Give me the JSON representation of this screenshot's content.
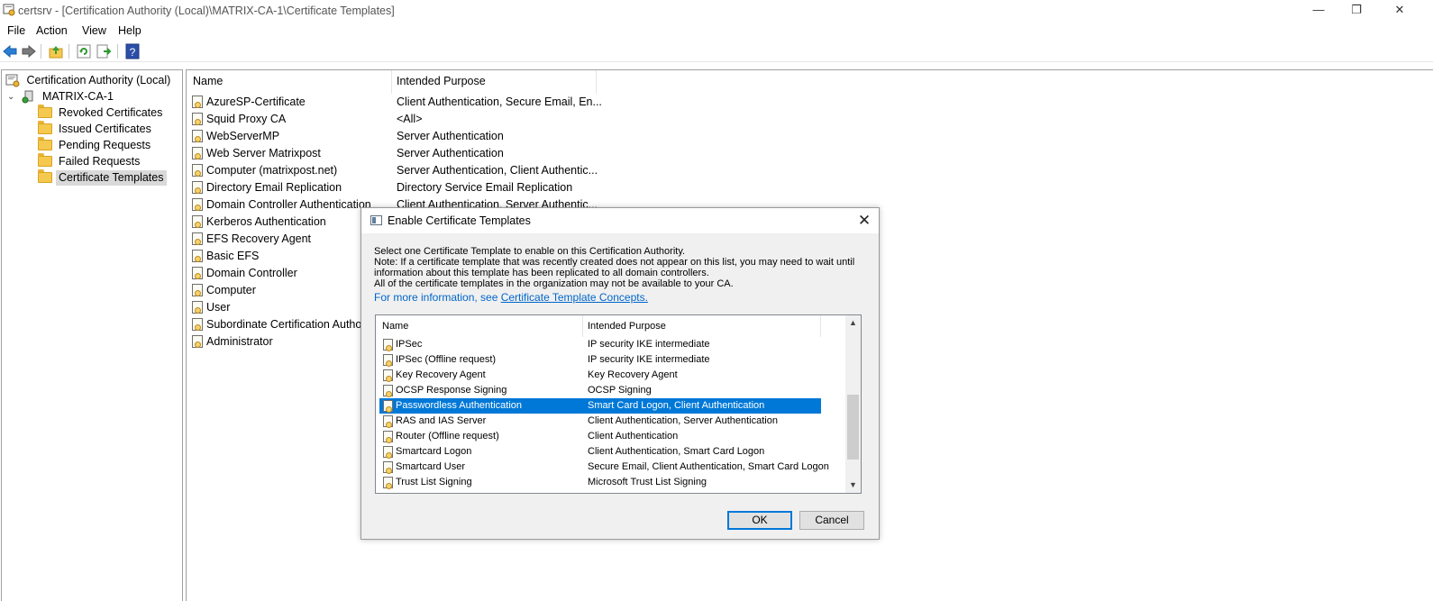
{
  "window": {
    "title": "certsrv - [Certification Authority (Local)\\MATRIX-CA-1\\Certificate Templates]",
    "minimize_glyph": "—",
    "restore_glyph": "❐",
    "close_glyph": "✕"
  },
  "menu": [
    "File",
    "Action",
    "View",
    "Help"
  ],
  "toolbar": {
    "icons": [
      "back-arrow-icon",
      "forward-arrow-icon",
      "up-folder-icon",
      "refresh-icon",
      "export-list-icon",
      "help-icon"
    ],
    "help_glyph": "?"
  },
  "tree": {
    "root": "Certification Authority (Local)",
    "ca": "MATRIX-CA-1",
    "items": [
      "Revoked Certificates",
      "Issued Certificates",
      "Pending Requests",
      "Failed Requests",
      "Certificate Templates"
    ],
    "selected": "Certificate Templates"
  },
  "list": {
    "headers": {
      "name": "Name",
      "purpose": "Intended Purpose"
    },
    "rows": [
      {
        "name": "AzureSP-Certificate",
        "purpose": "Client Authentication, Secure Email, En..."
      },
      {
        "name": "Squid Proxy CA",
        "purpose": "<All>"
      },
      {
        "name": "WebServerMP",
        "purpose": "Server Authentication"
      },
      {
        "name": " Web Server Matrixpost",
        "purpose": "Server Authentication"
      },
      {
        "name": "Computer (matrixpost.net)",
        "purpose": "Server Authentication, Client Authentic..."
      },
      {
        "name": "Directory Email Replication",
        "purpose": "Directory Service Email Replication"
      },
      {
        "name": "Domain Controller Authentication",
        "purpose": "Client Authentication, Server Authentic..."
      },
      {
        "name": "Kerberos Authentication",
        "purpose": ""
      },
      {
        "name": "EFS Recovery Agent",
        "purpose": ""
      },
      {
        "name": "Basic EFS",
        "purpose": ""
      },
      {
        "name": "Domain Controller",
        "purpose": ""
      },
      {
        "name": "Computer",
        "purpose": ""
      },
      {
        "name": "User",
        "purpose": ""
      },
      {
        "name": "Subordinate Certification Authority",
        "purpose": ""
      },
      {
        "name": "Administrator",
        "purpose": ""
      }
    ]
  },
  "dialog": {
    "title": "Enable Certificate Templates",
    "close_glyph": "✕",
    "text_lines": [
      "Select one Certificate Template to enable on this Certification Authority.",
      "Note: If a certificate template that was recently created does not appear on this list, you may need to wait until",
      "information about this template has been replicated to all domain controllers.",
      "All of the certificate templates in the organization may not be available to your CA."
    ],
    "more_info_prefix": "For more information, see ",
    "more_info_link": "Certificate Template Concepts.",
    "list_headers": {
      "name": "Name",
      "purpose": "Intended Purpose"
    },
    "rows": [
      {
        "name": "IPSec",
        "purpose": "IP security IKE intermediate"
      },
      {
        "name": "IPSec (Offline request)",
        "purpose": "IP security IKE intermediate"
      },
      {
        "name": "Key Recovery Agent",
        "purpose": "Key Recovery Agent"
      },
      {
        "name": "OCSP Response Signing",
        "purpose": "OCSP Signing"
      },
      {
        "name": "Passwordless Authentication",
        "purpose": "Smart Card Logon, Client Authentication"
      },
      {
        "name": "RAS and IAS Server",
        "purpose": "Client Authentication, Server Authentication"
      },
      {
        "name": "Router (Offline request)",
        "purpose": "Client Authentication"
      },
      {
        "name": "Smartcard Logon",
        "purpose": "Client Authentication, Smart Card Logon"
      },
      {
        "name": "Smartcard User",
        "purpose": "Secure Email, Client Authentication, Smart Card Logon"
      },
      {
        "name": "Trust List Signing",
        "purpose": "Microsoft Trust List Signing"
      }
    ],
    "selected_row": "Passwordless Authentication",
    "scroll_up_glyph": "▲",
    "scroll_down_glyph": "▼",
    "ok_label": "OK",
    "cancel_label": "Cancel"
  }
}
